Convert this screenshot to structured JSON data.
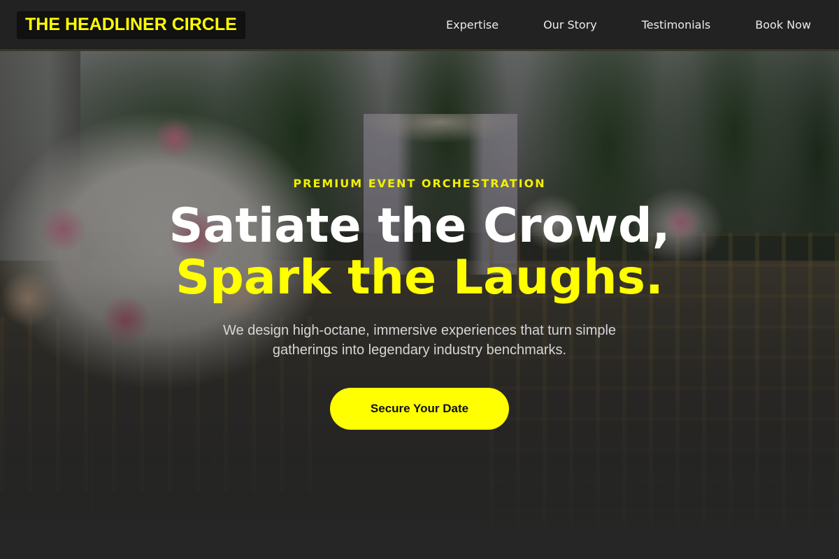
{
  "brand": {
    "logo_text": "THE HEADLINER CIRCLE",
    "accent_color": "#ffff00"
  },
  "nav": {
    "items": [
      {
        "label": "Expertise"
      },
      {
        "label": "Our Story"
      },
      {
        "label": "Testimonials"
      },
      {
        "label": "Book Now"
      }
    ]
  },
  "hero": {
    "eyebrow": "PREMIUM EVENT ORCHESTRATION",
    "headline_line1": "Satiate the Crowd,",
    "headline_line2": "Spark the Laughs.",
    "subtext": "We design high-octane, immersive experiences that turn simple gatherings into legendary industry benchmarks.",
    "cta_label": "Secure Your Date",
    "background_image": "outdoor wedding ceremony with floral bouquets, white arch and rows of chairs"
  }
}
